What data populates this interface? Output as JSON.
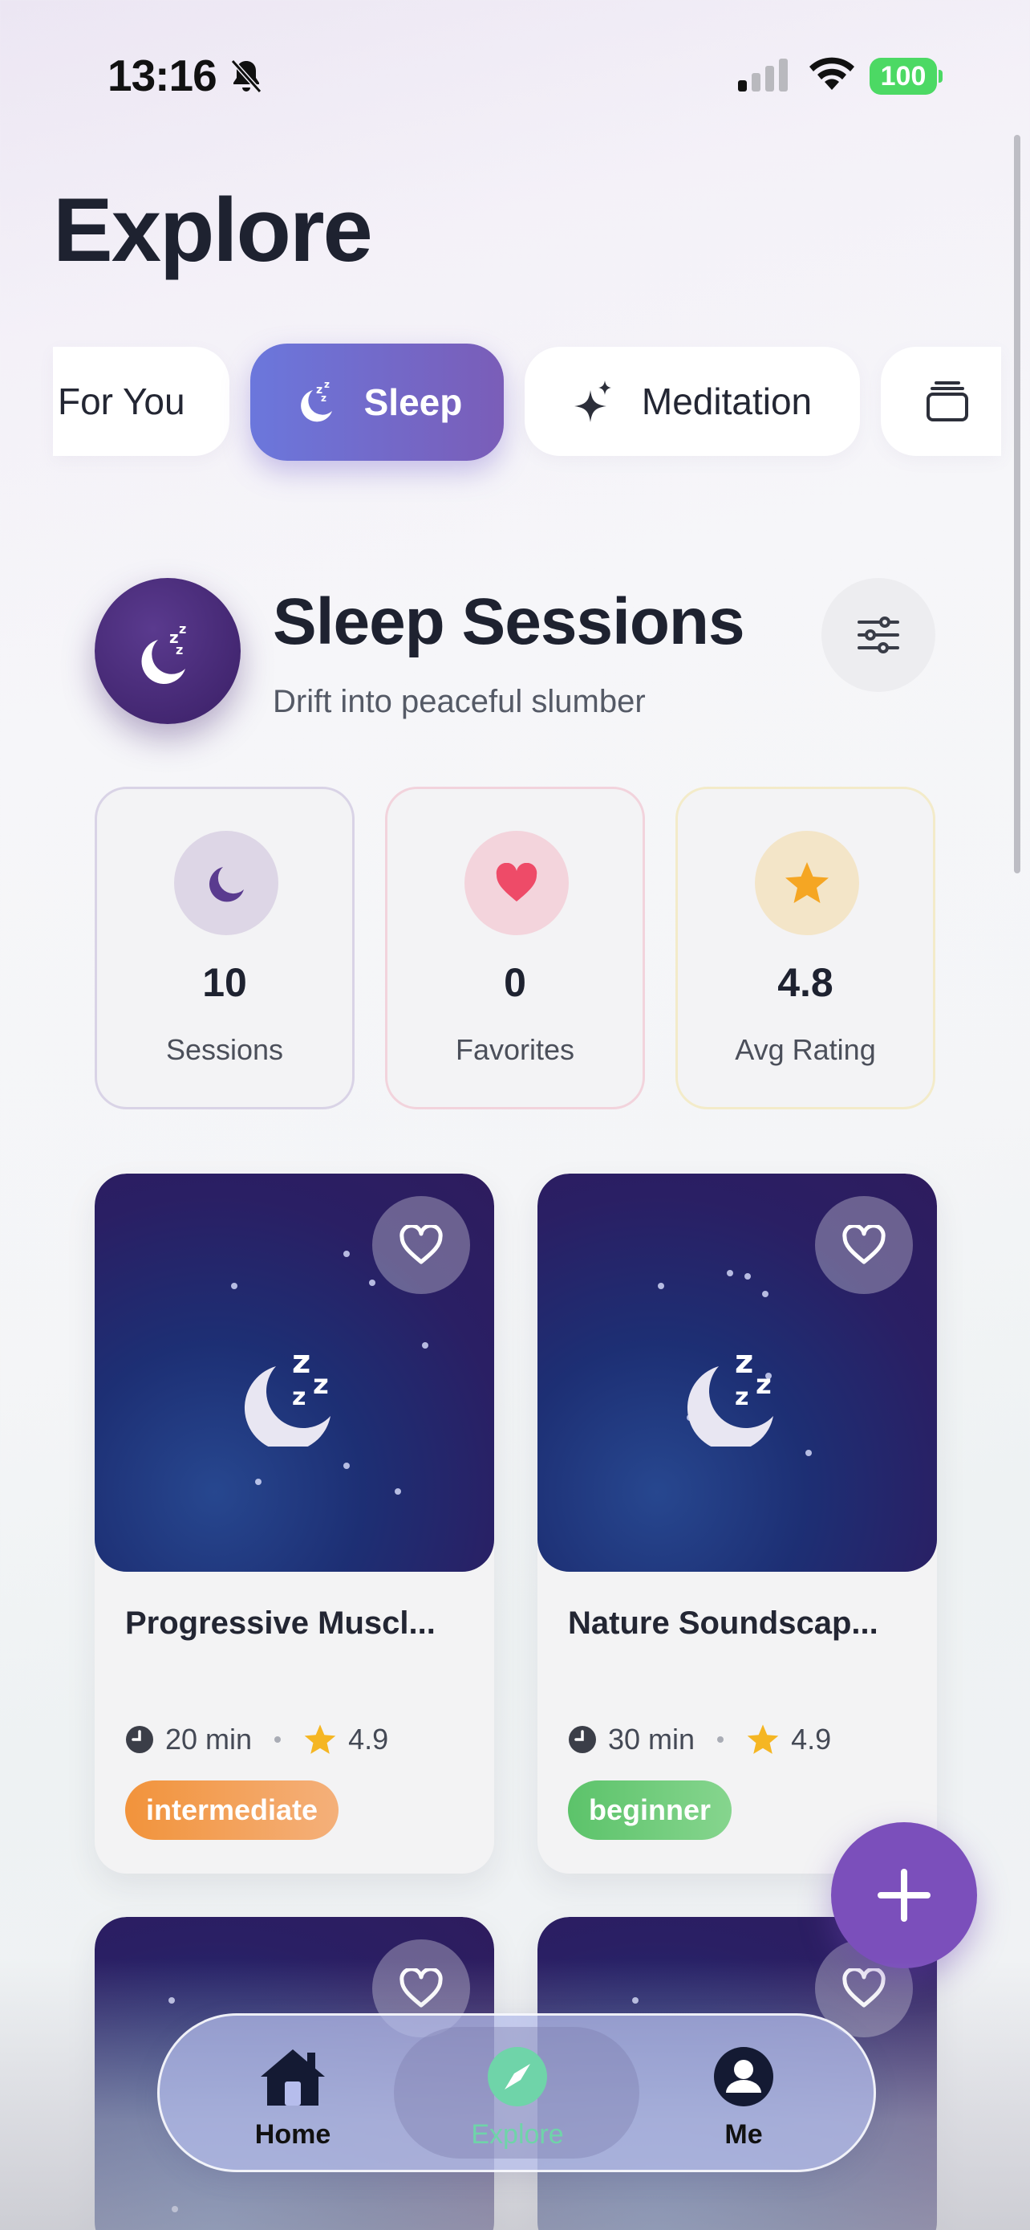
{
  "status_bar": {
    "time": "13:16",
    "battery": "100"
  },
  "page": {
    "title": "Explore"
  },
  "tabs": [
    {
      "label": "For You"
    },
    {
      "label": "Sleep"
    },
    {
      "label": "Meditation"
    }
  ],
  "section": {
    "title": "Sleep Sessions",
    "subtitle": "Drift into peaceful slumber"
  },
  "stats": [
    {
      "value": "10",
      "label": "Sessions"
    },
    {
      "value": "0",
      "label": "Favorites"
    },
    {
      "value": "4.8",
      "label": "Avg Rating"
    }
  ],
  "sessions": [
    {
      "title": "Progressive Muscl...",
      "duration": "20 min",
      "rating": "4.9",
      "level": "intermediate"
    },
    {
      "title": "Nature Soundscap...",
      "duration": "30 min",
      "rating": "4.9",
      "level": "beginner"
    }
  ],
  "nav": {
    "home": "Home",
    "explore": "Explore",
    "me": "Me"
  },
  "colors": {
    "accent": "#7b4fbb",
    "sleep_tab": "#6b77dc",
    "intermediate": "#f2933b",
    "beginner": "#5cc36a"
  }
}
